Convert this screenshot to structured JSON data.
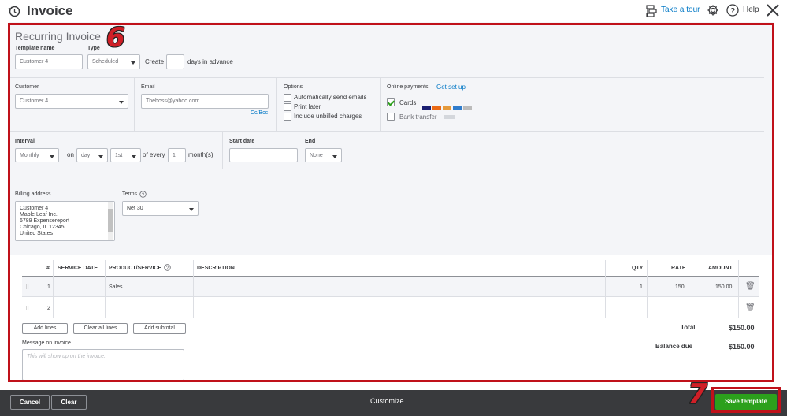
{
  "header": {
    "title": "Invoice",
    "tour_label": "Take a tour",
    "help_label": "Help"
  },
  "annotations": {
    "step6": "6",
    "step7": "7"
  },
  "form": {
    "heading": "Recurring Invoice",
    "template_name_label": "Template name",
    "template_name_value": "Customer 4",
    "type_label": "Type",
    "type_value": "Scheduled",
    "create_label": "Create",
    "create_value": "",
    "days_advance_label": "days in advance",
    "customer_label": "Customer",
    "customer_value": "Customer 4",
    "email_label": "Email",
    "email_value": "Theboss@yahoo.com",
    "cc_bcc": "Cc/Bcc",
    "options_label": "Options",
    "options": [
      {
        "label": "Automatically send emails",
        "checked": false
      },
      {
        "label": "Print later",
        "checked": false
      },
      {
        "label": "Include unbilled charges",
        "checked": false
      }
    ],
    "online_payments_label": "Online payments",
    "get_set_up": "Get set up",
    "cards_label": "Cards",
    "cards_checked": true,
    "bank_transfer_label": "Bank transfer",
    "bank_transfer_checked": false,
    "interval_label": "Interval",
    "interval_value": "Monthly",
    "on_label": "on",
    "on_day_value": "day",
    "on_ordinal_value": "1st",
    "of_every_label": "of every",
    "of_every_value": "1",
    "months_label": "month(s)",
    "start_date_label": "Start date",
    "start_date_value": "",
    "end_label": "End",
    "end_value": "None",
    "billing_address_label": "Billing address",
    "billing_address_lines": [
      "Customer 4",
      "Maple Leaf Inc.",
      "6789 Expensereport",
      "Chicago, IL  12345",
      "United States"
    ],
    "terms_label": "Terms",
    "terms_value": "Net 30"
  },
  "table": {
    "columns": [
      "#",
      "SERVICE DATE",
      "PRODUCT/SERVICE",
      "DESCRIPTION",
      "QTY",
      "RATE",
      "AMOUNT"
    ],
    "rows": [
      {
        "num": "1",
        "service_date": "",
        "product": "Sales",
        "description": "",
        "qty": "1",
        "rate": "150",
        "amount": "150.00"
      },
      {
        "num": "2",
        "service_date": "",
        "product": "",
        "description": "",
        "qty": "",
        "rate": "",
        "amount": ""
      }
    ],
    "add_lines": "Add lines",
    "clear_all_lines": "Clear all lines",
    "add_subtotal": "Add subtotal"
  },
  "totals": {
    "total_label": "Total",
    "total_value": "$150.00",
    "balance_due_label": "Balance due",
    "balance_due_value": "$150.00"
  },
  "message": {
    "label": "Message on invoice",
    "placeholder": "This will show up on the invoice."
  },
  "footer": {
    "cancel": "Cancel",
    "clear": "Clear",
    "customize": "Customize",
    "save_template": "Save template"
  },
  "colors": {
    "accent_green": "#2ca01c",
    "link_blue": "#0077c5",
    "annotation_red": "#c0111a",
    "footer_bg": "#393a3d"
  }
}
